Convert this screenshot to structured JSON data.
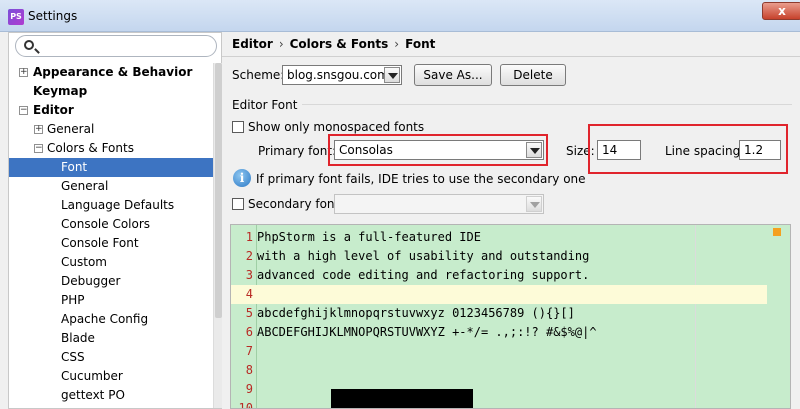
{
  "window": {
    "title": "Settings",
    "app_icon": "PS",
    "close_label": "x"
  },
  "search": {
    "placeholder": ""
  },
  "tree": {
    "appearance": "Appearance & Behavior",
    "keymap": "Keymap",
    "editor": "Editor",
    "general": "General",
    "colors_fonts": "Colors & Fonts",
    "children": [
      "Font",
      "General",
      "Language Defaults",
      "Console Colors",
      "Console Font",
      "Custom",
      "Debugger",
      "PHP",
      "Apache Config",
      "Blade",
      "CSS",
      "Cucumber",
      "gettext PO"
    ],
    "selected": "Font"
  },
  "breadcrumb": {
    "part1": "Editor",
    "part2": "Colors & Fonts",
    "part3": "Font",
    "separator": "›"
  },
  "scheme": {
    "label": "Scheme:",
    "value": "blog.snsgou.com",
    "save_as": "Save As...",
    "delete": "Delete"
  },
  "editor_font": {
    "section_title": "Editor Font",
    "monospaced_label": "Show only monospaced fonts",
    "monospaced_checked": false,
    "primary_label": "Primary font:",
    "primary_value": "Consolas",
    "size_label": "Size:",
    "size_value": "14",
    "line_spacing_label": "Line spacing:",
    "line_spacing_value": "1.2",
    "info_text": "If primary font fails, IDE tries to use the secondary one",
    "secondary_label": "Secondary font:",
    "secondary_value": "",
    "secondary_checked": false
  },
  "preview": {
    "background": "#c7eccc",
    "caret_row_color": "#fdfbd8",
    "line_number_color": "#b82a24",
    "lines": [
      {
        "num": "1",
        "text": "PhpStorm is a full-featured IDE"
      },
      {
        "num": "2",
        "text": "with a high level of usability and outstanding"
      },
      {
        "num": "3",
        "text": "advanced code editing and refactoring support."
      },
      {
        "num": "4",
        "text": ""
      },
      {
        "num": "5",
        "text": "abcdefghijklmnopqrstuvwxyz 0123456789 (){}[]"
      },
      {
        "num": "6",
        "text": "ABCDEFGHIJKLMNOPQRSTUVWXYZ +-*/= .,;:!? #&$%@|^"
      },
      {
        "num": "7",
        "text": ""
      },
      {
        "num": "8",
        "text": ""
      },
      {
        "num": "9",
        "text": ""
      },
      {
        "num": "10",
        "text": ""
      }
    ]
  },
  "colors": {
    "selection": "#3d74c2",
    "highlight_box": "#e0242c",
    "marker": "#f4a020"
  }
}
